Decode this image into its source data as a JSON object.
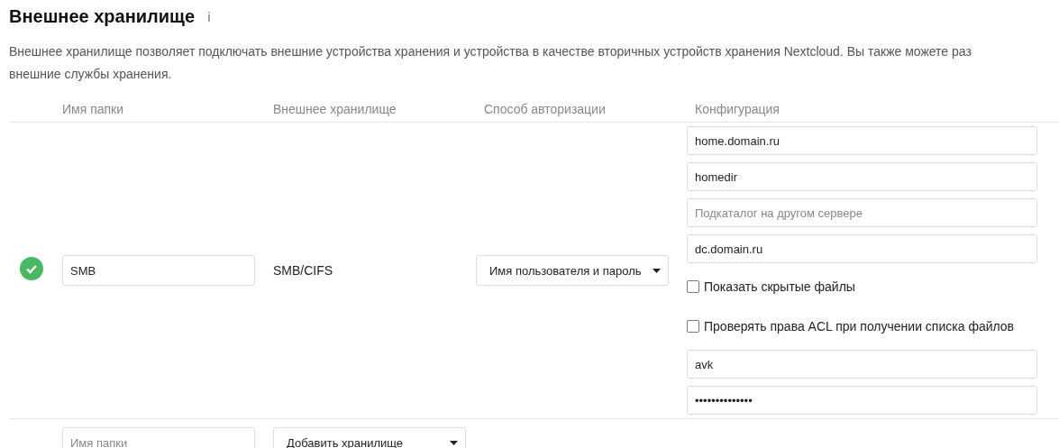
{
  "title": "Внешнее хранилище",
  "info_icon": "ℹ",
  "description_lines": [
    "Внешнее хранилище позволяет подключать внешние устройства хранения и устройства в качестве вторичных устройств хранения Nextcloud. Вы также можете раз",
    "внешние службы хранения."
  ],
  "table": {
    "columns": [
      "Имя папки",
      "Внешнее хранилище",
      "Способ авторизации",
      "Конфигурация"
    ],
    "rows": [
      {
        "ok": true,
        "folder_name": "SMB",
        "backend": "SMB/CIFS",
        "auth": "Имя пользователя и пароль",
        "config": [
          {
            "kind": "text",
            "value": "home.domain.ru"
          },
          {
            "kind": "text",
            "value": "homedir"
          },
          {
            "kind": "text",
            "placeholder": "Подкаталог на другом сервере"
          },
          {
            "kind": "text",
            "value": "dc.domain.ru"
          },
          {
            "kind": "checkbox",
            "label": "Показать скрытые файлы",
            "checked": false
          },
          {
            "kind": "checkbox",
            "label": "Проверять права ACL при получении списка файлов",
            "checked": false
          },
          {
            "kind": "text",
            "value": "avk"
          },
          {
            "kind": "password",
            "value": "••••••••••••••"
          }
        ]
      }
    ],
    "new_row": {
      "folder_placeholder": "Имя папки",
      "add_label": "Добавить хранилище"
    }
  }
}
